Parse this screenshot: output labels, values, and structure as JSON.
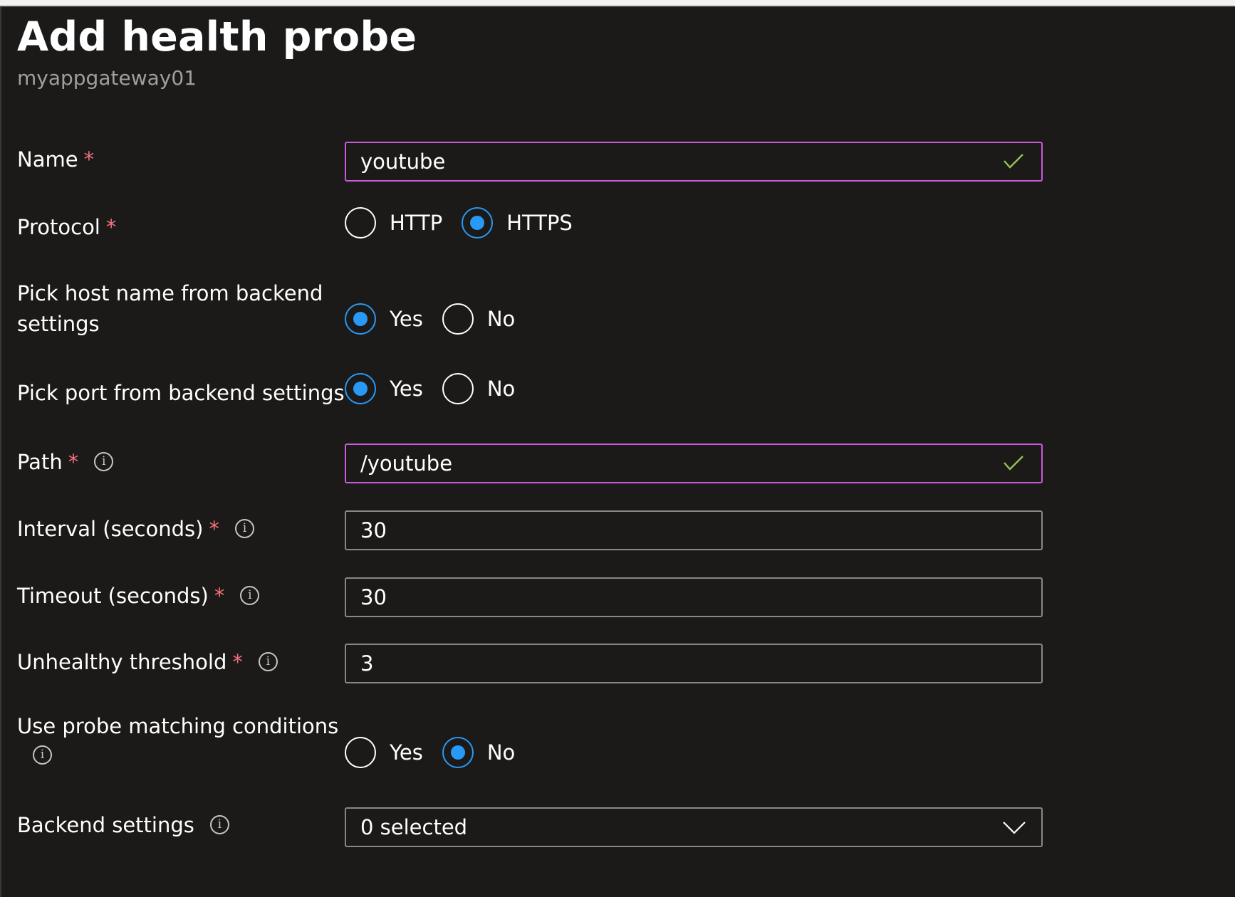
{
  "header": {
    "title": "Add health probe",
    "subtitle": "myappgateway01"
  },
  "form": {
    "required_marker": "*",
    "name": {
      "label": "Name",
      "value": "youtube",
      "validated": true
    },
    "protocol": {
      "label": "Protocol",
      "options": [
        "HTTP",
        "HTTPS"
      ],
      "selected": "HTTPS"
    },
    "pick_host_name": {
      "label_line1": "Pick host name from backend",
      "label_line2": "settings",
      "options": [
        "Yes",
        "No"
      ],
      "selected": "Yes"
    },
    "pick_port": {
      "label": "Pick port from backend settings",
      "options": [
        "Yes",
        "No"
      ],
      "selected": "Yes"
    },
    "path": {
      "label": "Path",
      "value": "/youtube",
      "validated": true
    },
    "interval": {
      "label": "Interval (seconds)",
      "value": "30"
    },
    "timeout": {
      "label": "Timeout (seconds)",
      "value": "30"
    },
    "unhealthy_threshold": {
      "label": "Unhealthy threshold",
      "value": "3"
    },
    "probe_matching": {
      "label": "Use probe matching conditions",
      "options": [
        "Yes",
        "No"
      ],
      "selected": "No"
    },
    "backend_settings": {
      "label": "Backend settings",
      "value": "0 selected"
    }
  },
  "colors": {
    "background": "#1b1a19",
    "accent": "#2899f5",
    "required": "#f1707b",
    "valid_border": "#c75bd9",
    "check": "#92c353"
  },
  "icons": {
    "info": "info-icon",
    "check": "checkmark-icon",
    "dropdown": "chevron-down-icon"
  }
}
